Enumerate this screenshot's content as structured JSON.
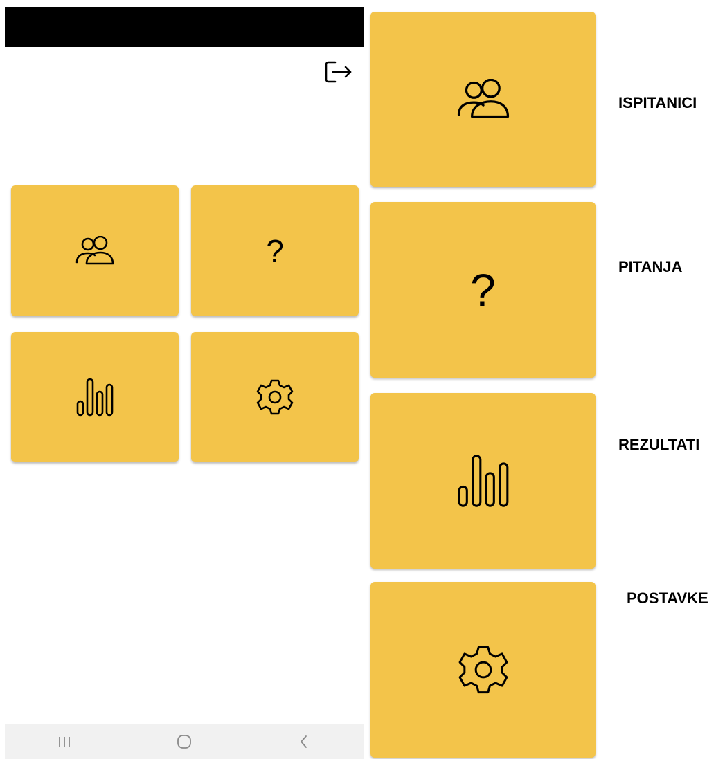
{
  "app": {
    "accent_color": "#f3c44a"
  },
  "phone": {
    "header": {
      "logout_icon": "logout-icon"
    },
    "tiles": [
      {
        "icon": "users-icon"
      },
      {
        "icon": "question-icon",
        "glyph": "?"
      },
      {
        "icon": "bar-chart-icon"
      },
      {
        "icon": "gear-icon"
      }
    ],
    "navbar": {
      "recents_icon": "recents-icon",
      "home_icon": "home-icon",
      "back_icon": "back-icon"
    }
  },
  "legend": [
    {
      "icon": "users-icon",
      "label": "ISPITANICI"
    },
    {
      "icon": "question-icon",
      "glyph": "?",
      "label": "PITANJA"
    },
    {
      "icon": "bar-chart-icon",
      "label": "REZULTATI"
    },
    {
      "icon": "gear-icon",
      "label": "POSTAVKE"
    }
  ]
}
